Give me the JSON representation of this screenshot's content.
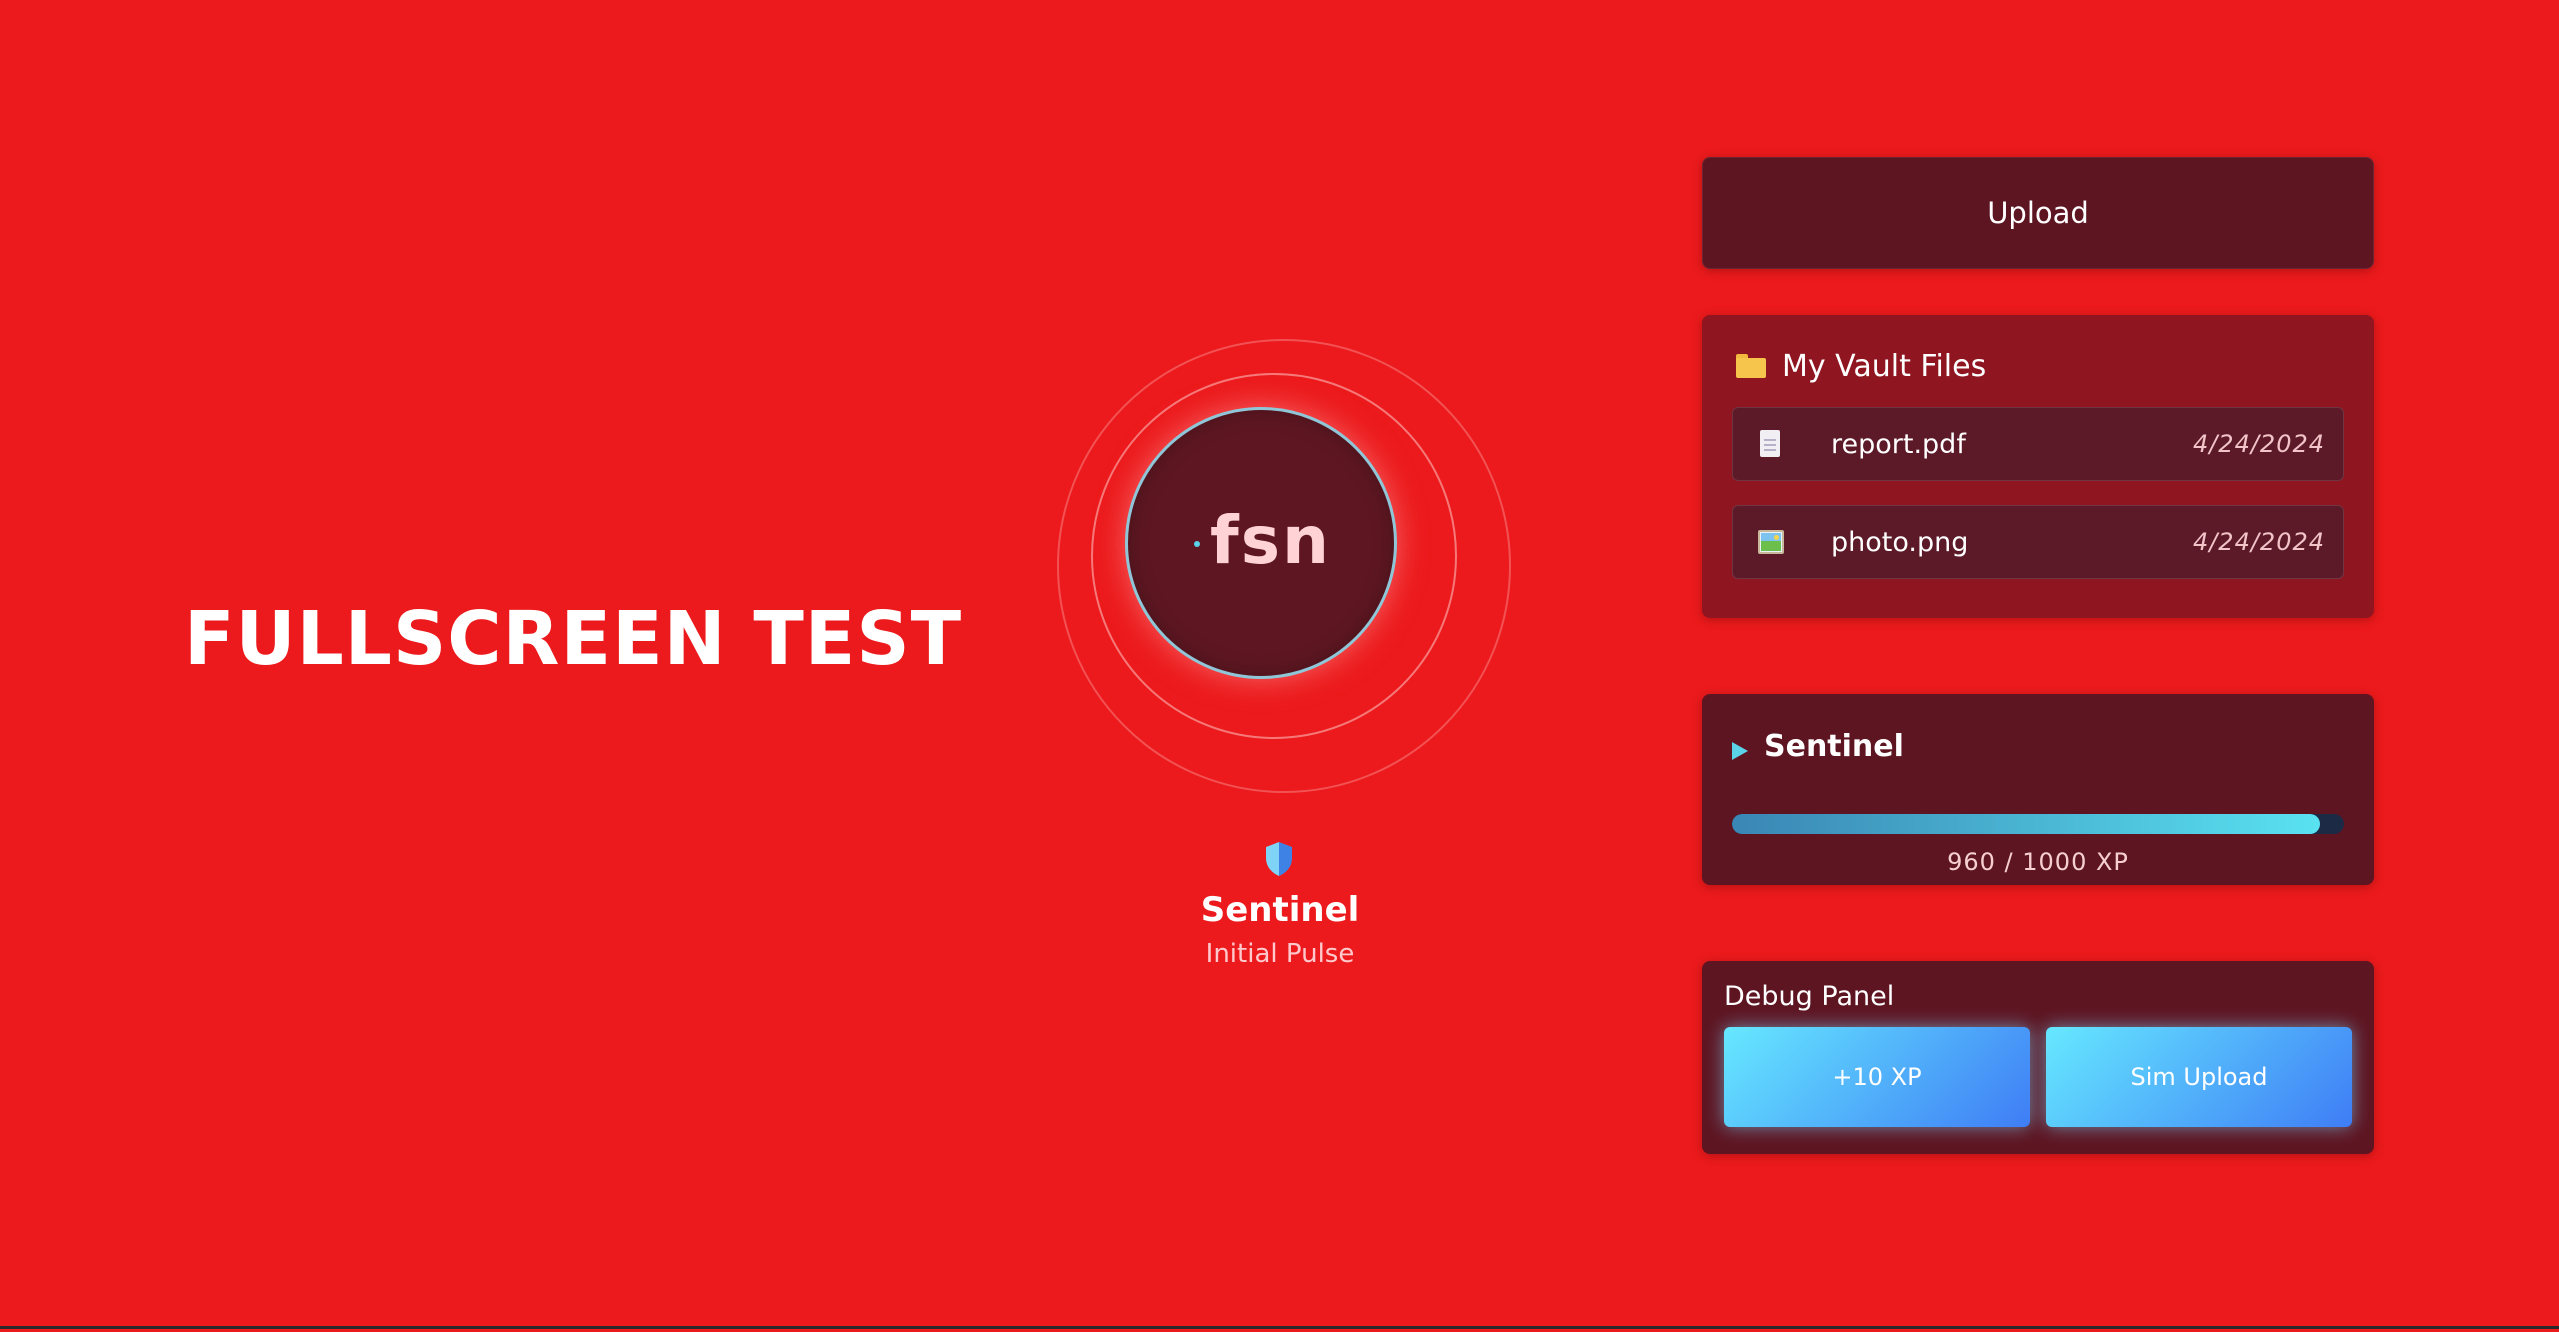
{
  "hero": {
    "title": "FULLSCREEN TEST"
  },
  "orb": {
    "label": "fsn",
    "name": "Sentinel",
    "subtitle": "Initial Pulse",
    "shield_icon": "shield-icon"
  },
  "upload": {
    "label": "Upload"
  },
  "vault": {
    "title": "My Vault Files",
    "icon": "folder-icon",
    "files": [
      {
        "name": "report.pdf",
        "date": "4/24/2024",
        "icon": "document-icon"
      },
      {
        "name": "photo.png",
        "date": "4/24/2024",
        "icon": "image-icon"
      }
    ]
  },
  "sentinel": {
    "title": "Sentinel",
    "icon": "play-icon",
    "xp_current": 960,
    "xp_max": 1000,
    "xp_text": "960 / 1000 XP"
  },
  "debug": {
    "title": "Debug Panel",
    "add_xp_label": "+10 XP",
    "sim_upload_label": "Sim Upload"
  },
  "colors": {
    "background": "#ec1a1c",
    "panel": "#5e1522",
    "vault_panel": "#8f1520",
    "accent_cyan": "#5ad2e8",
    "button_gradient_start": "#66e8ff",
    "button_gradient_end": "#3f7df6"
  }
}
